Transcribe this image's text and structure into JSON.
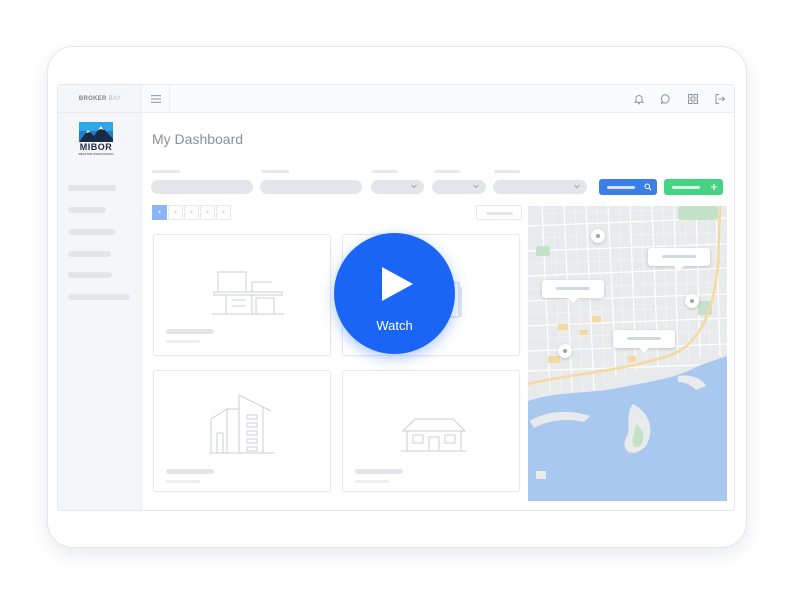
{
  "app": {
    "brand_bold": "BROKER",
    "brand_light": "BAY",
    "logo_text": "MIBOR",
    "logo_sub": "REALTOR ASSOCIATION"
  },
  "page": {
    "title": "My Dashboard"
  },
  "topbar": {
    "icons": [
      "menu-icon",
      "bell-icon",
      "chat-icon",
      "grid-icon",
      "logout-icon"
    ]
  },
  "pagination": {
    "active": "+",
    "pages": [
      "+",
      "+",
      "+",
      "+",
      "+"
    ]
  },
  "video_overlay": {
    "label": "Watch"
  },
  "colors": {
    "accent_blue": "#1a65f5",
    "button_blue": "#3b7fe6",
    "button_green": "#46d383",
    "map_water": "#a9c8f0",
    "map_park": "#c3e2c7",
    "map_highway": "#f5d9a0"
  }
}
